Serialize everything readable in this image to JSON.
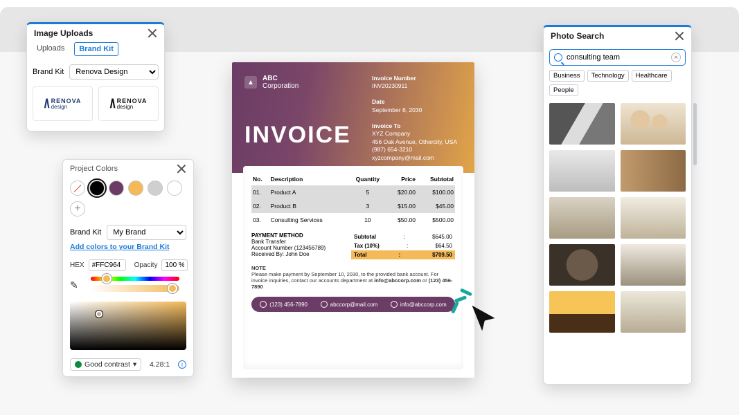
{
  "uploads": {
    "title": "Image Uploads",
    "tabs": {
      "uploads": "Uploads",
      "brandkit": "Brand Kit"
    },
    "brandkit_label": "Brand Kit",
    "brandkit_selected": "Renova Design",
    "logo_line1": "RENOVA",
    "logo_line2": "design"
  },
  "colors": {
    "title": "Project Colors",
    "swatches": {
      "black": "#000000",
      "plum": "#6b3c66",
      "amber": "#f4b959",
      "grey": "#cfcfcf",
      "white": "#ffffff"
    },
    "brandkit_label": "Brand Kit",
    "brandkit_selected": "My Brand",
    "add_link": "Add colors to your Brand Kit",
    "hex_label": "HEX",
    "hex_value": "#FFC964",
    "opacity_label": "Opacity",
    "opacity_value": "100 %",
    "contrast_text": "Good contrast",
    "contrast_ratio": "4.28:1"
  },
  "invoice": {
    "brand_line1": "ABC",
    "brand_line2": "Corporation",
    "title": "INVOICE",
    "meta_number_label": "Invoice Number",
    "meta_number": "INV20230911",
    "meta_date_label": "Date",
    "meta_date": "September 8, 2030",
    "meta_to_label": "Invoice To",
    "meta_to_name": "XYZ Company",
    "meta_to_addr": "456 Oak Avenue, Othercity, USA",
    "meta_to_phone": "(987) 654-3210",
    "meta_to_email": "xyzcompany@mail.com",
    "cols": {
      "no": "No.",
      "desc": "Description",
      "qty": "Quantity",
      "price": "Price",
      "sub": "Subtotal"
    },
    "rows": [
      {
        "no": "01.",
        "desc": "Product A",
        "qty": "5",
        "price": "$20.00",
        "sub": "$100.00"
      },
      {
        "no": "02.",
        "desc": "Product B",
        "qty": "3",
        "price": "$15.00",
        "sub": "$45.00"
      },
      {
        "no": "03.",
        "desc": "Consulting Services",
        "qty": "10",
        "price": "$50.00",
        "sub": "$500.00"
      }
    ],
    "payment_title": "PAYMENT METHOD",
    "payment_method": "Bank Transfer",
    "payment_account": "Account Number (123456789)",
    "payment_received": "Received By: John Doe",
    "totals": {
      "subtotal_label": "Subtotal",
      "subtotal": "$645.00",
      "tax_label": "Tax (10%)",
      "tax": "$64.50",
      "total_label": "Total",
      "total": "$709.50"
    },
    "note_title": "NOTE",
    "note_body1": "Please make payment by September 10, 2030, to the provided bank account. For invoice inquiries, contact our accounts department at ",
    "note_email": "info@abccorp.com",
    "note_body2": " or ",
    "note_phone": "(123) 456-7890",
    "foot_phone": "(123) 456-7890",
    "foot_email1": "abccorp@mail.com",
    "foot_email2": "info@abccorp.com"
  },
  "photos": {
    "title": "Photo Search",
    "query": "consulting team",
    "chips": {
      "c1": "Business",
      "c2": "Technology",
      "c3": "Healthcare",
      "c4": "People"
    }
  }
}
